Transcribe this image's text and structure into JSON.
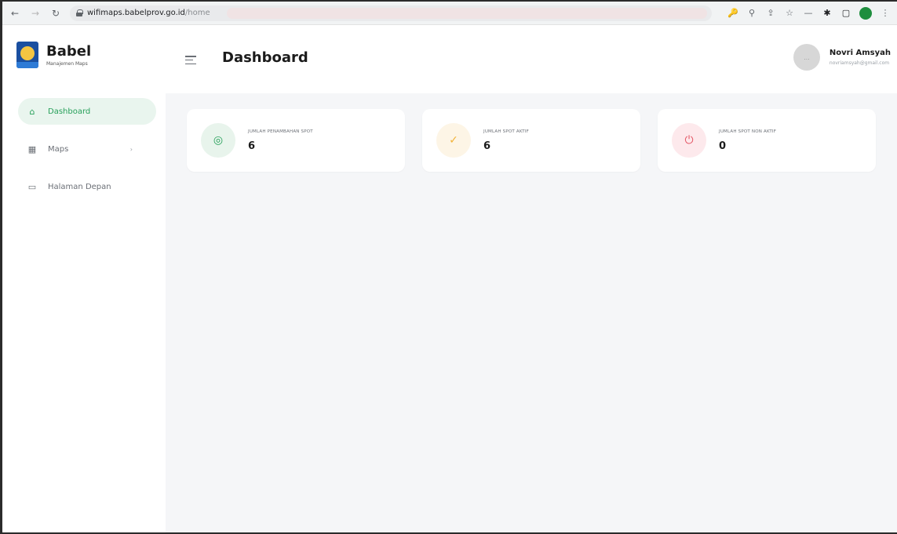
{
  "browser": {
    "url_host": "wifimaps.babelprov.go.id",
    "url_path": "/home"
  },
  "brand": {
    "name": "Babel",
    "subtitle": "Manajemen Maps"
  },
  "sidebar": {
    "items": [
      {
        "label": "Dashboard",
        "icon": "home-icon",
        "active": true
      },
      {
        "label": "Maps",
        "icon": "grid-icon",
        "has_submenu": true
      },
      {
        "label": "Halaman Depan",
        "icon": "monitor-icon"
      }
    ]
  },
  "header": {
    "title": "Dashboard"
  },
  "user": {
    "name": "Novri Amsyah",
    "email": "novriamsyah@gmail.com",
    "avatar_text": "..."
  },
  "cards": [
    {
      "label": "JUMLAH PENAMBAHAN SPOT",
      "value": "6",
      "icon": "location-pin-icon",
      "color": "#27a05a",
      "bg": "#e8f4ec"
    },
    {
      "label": "JUMLAH SPOT AKTIF",
      "value": "6",
      "icon": "check-circle-icon",
      "color": "#f2b33a",
      "bg": "#fdf5e6"
    },
    {
      "label": "JUMLAH SPOT NON AKTIF",
      "value": "0",
      "icon": "power-icon",
      "color": "#e45766",
      "bg": "#fde9ec"
    }
  ]
}
